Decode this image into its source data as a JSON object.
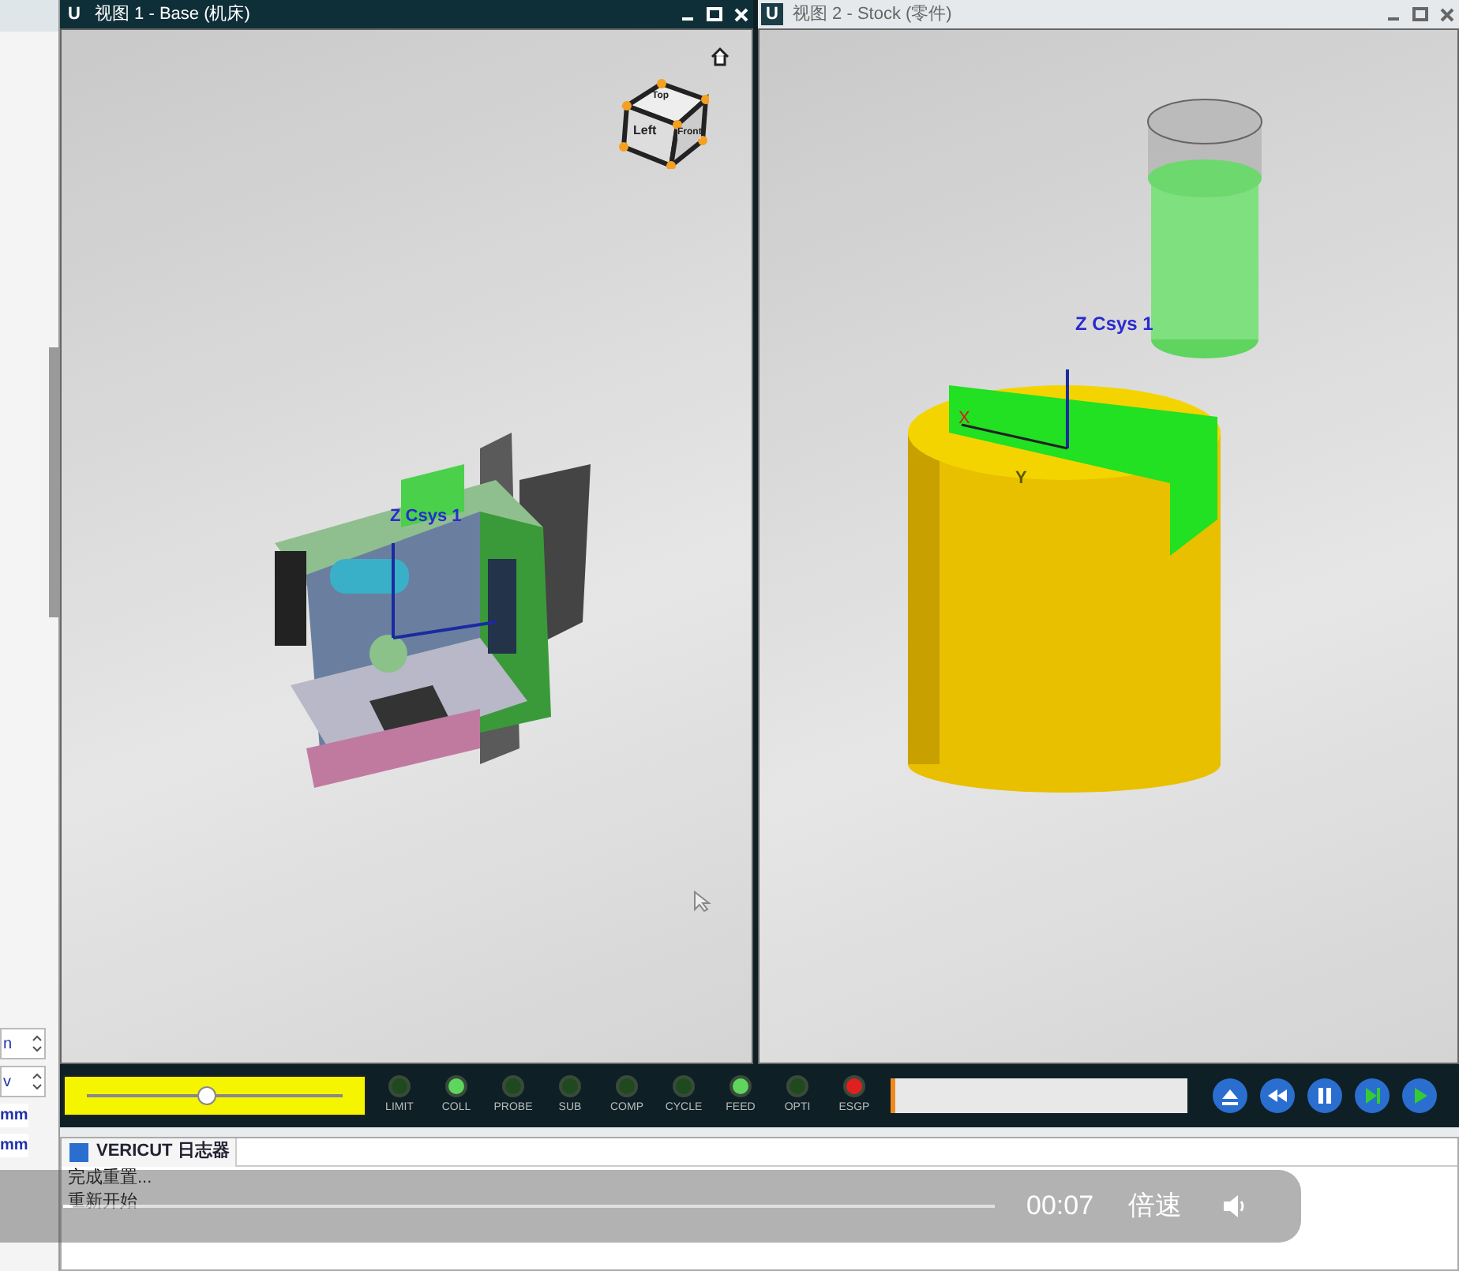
{
  "left_panel": {
    "fields": [
      {
        "value": "n"
      },
      {
        "value": "v"
      }
    ],
    "units": [
      "mm",
      "mm"
    ]
  },
  "views": [
    {
      "icon": "U",
      "title": "视图 1 - Base (机床)",
      "active": true,
      "kind": "machine",
      "cube": [
        "Top",
        "Left",
        "Front"
      ],
      "axis_label": "Z Csys 1"
    },
    {
      "icon": "U",
      "title": "视图 2 - Stock (零件)",
      "active": false,
      "kind": "stock",
      "axis_label": "Z Csys 1",
      "x_label": "X",
      "y_label": "Y"
    }
  ],
  "toolbar": {
    "slider": {
      "level": 0.47
    },
    "leds": [
      {
        "label": "LIMIT",
        "color": "#1f4a1f"
      },
      {
        "label": "COLL",
        "color": "#5ed65e"
      },
      {
        "label": "PROBE",
        "color": "#1f4a1f"
      },
      {
        "label": "SUB",
        "color": "#1f4a1f"
      },
      {
        "label": "COMP",
        "color": "#1f4a1f"
      },
      {
        "label": "CYCLE",
        "color": "#1f4a1f"
      },
      {
        "label": "FEED",
        "color": "#5ed65e"
      },
      {
        "label": "OPTI",
        "color": "#1f4a1f"
      },
      {
        "label": "ESGP",
        "color": "#e02020"
      }
    ],
    "buttons": [
      {
        "kind": "eject"
      },
      {
        "kind": "rewind"
      },
      {
        "kind": "pause"
      },
      {
        "kind": "step"
      },
      {
        "kind": "play"
      }
    ]
  },
  "log": {
    "tab": "VERICUT 日志器",
    "lines": [
      "完成重置...",
      "重新开始"
    ]
  },
  "player": {
    "progress": {
      "level": 0.01
    },
    "time": "00:07",
    "speed": "倍速"
  }
}
